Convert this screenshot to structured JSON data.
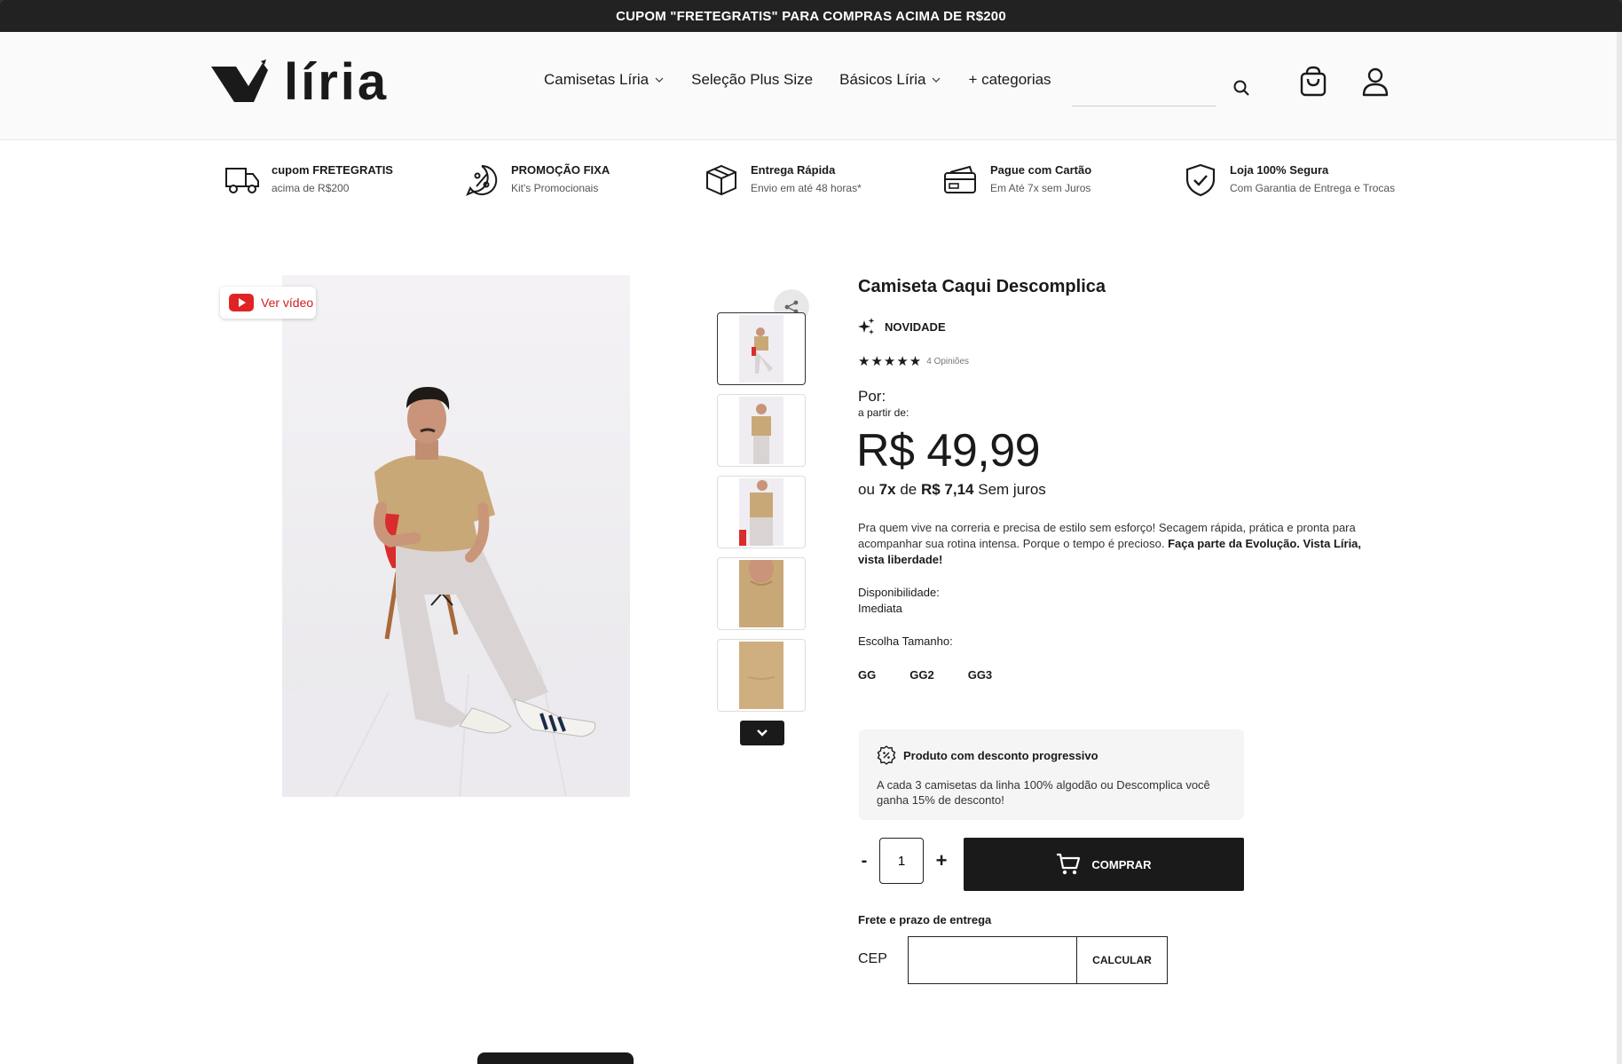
{
  "topbar": {
    "text": "CUPOM \"FRETEGRATIS\" PARA COMPRAS ACIMA DE R$200"
  },
  "header": {
    "logo_text": "líria",
    "nav": [
      {
        "label": "Camisetas Líria",
        "dropdown": true
      },
      {
        "label": "Seleção Plus Size",
        "dropdown": false
      },
      {
        "label": "Básicos Líria",
        "dropdown": true
      },
      {
        "label": "+ categorias",
        "dropdown": false
      }
    ],
    "search_placeholder": "",
    "icons": {
      "search": "search-icon",
      "cart": "shopping-bag-icon",
      "user": "user-icon"
    }
  },
  "benefits": [
    {
      "icon": "truck-icon",
      "title": "cupom FRETEGRATIS",
      "subtitle": "acima de R$200"
    },
    {
      "icon": "percent-badge-icon",
      "title": "PROMOÇÃO FIXA",
      "subtitle": "Kit's Promocionais"
    },
    {
      "icon": "box-icon",
      "title": "Entrega Rápida",
      "subtitle": "Envio em até 48 horas*"
    },
    {
      "icon": "credit-card-icon",
      "title": "Pague com Cartão",
      "subtitle": "Em Até 7x sem Juros"
    },
    {
      "icon": "shield-check-icon",
      "title": "Loja 100% Segura",
      "subtitle": "Com Garantia de Entrega e Trocas"
    }
  ],
  "gallery": {
    "video_label": "Ver vídeo",
    "thumbnail_count": 5,
    "active_thumbnail": 1
  },
  "product": {
    "title": "Camiseta Caqui Descomplica",
    "tag": "NOVIDADE",
    "rating": {
      "stars": 5,
      "count_label": "4 Opiniões"
    },
    "price_prefix": "Por:",
    "price_from": "a partir de:",
    "price": "R$ 49,99",
    "installment": {
      "prefix": "ou",
      "times": "7x",
      "middle": "de",
      "value": "R$ 7,14",
      "suffix": "Sem juros"
    },
    "description": "Pra quem vive na correria e precisa de estilo sem esforço! Secagem rápida, prática e pronta para acompanhar sua rotina intensa. Porque o tempo é precioso.",
    "description_bold": "Faça parte da Evolução. Vista Líria, vista liberdade!",
    "availability_label": "Disponibilidade:",
    "availability_value": "Imediata",
    "size_label": "Escolha Tamanho:",
    "sizes": [
      "GG",
      "GG2",
      "GG3"
    ]
  },
  "promo": {
    "title": "Produto com desconto progressivo",
    "text": "A cada 3 camisetas da linha 100% algodão ou Descomplica você ganha 15% de desconto!"
  },
  "purchase": {
    "minus": "-",
    "quantity": "1",
    "plus": "+",
    "buy_label": "COMPRAR"
  },
  "shipping": {
    "label": "Frete e prazo de entrega",
    "cep_label": "CEP",
    "cep_value": "",
    "calc_label": "CALCULAR"
  },
  "colors": {
    "dark": "#1a1a1a",
    "youtube_red": "#d21d1d",
    "promo_bg": "#f5f5f5"
  }
}
